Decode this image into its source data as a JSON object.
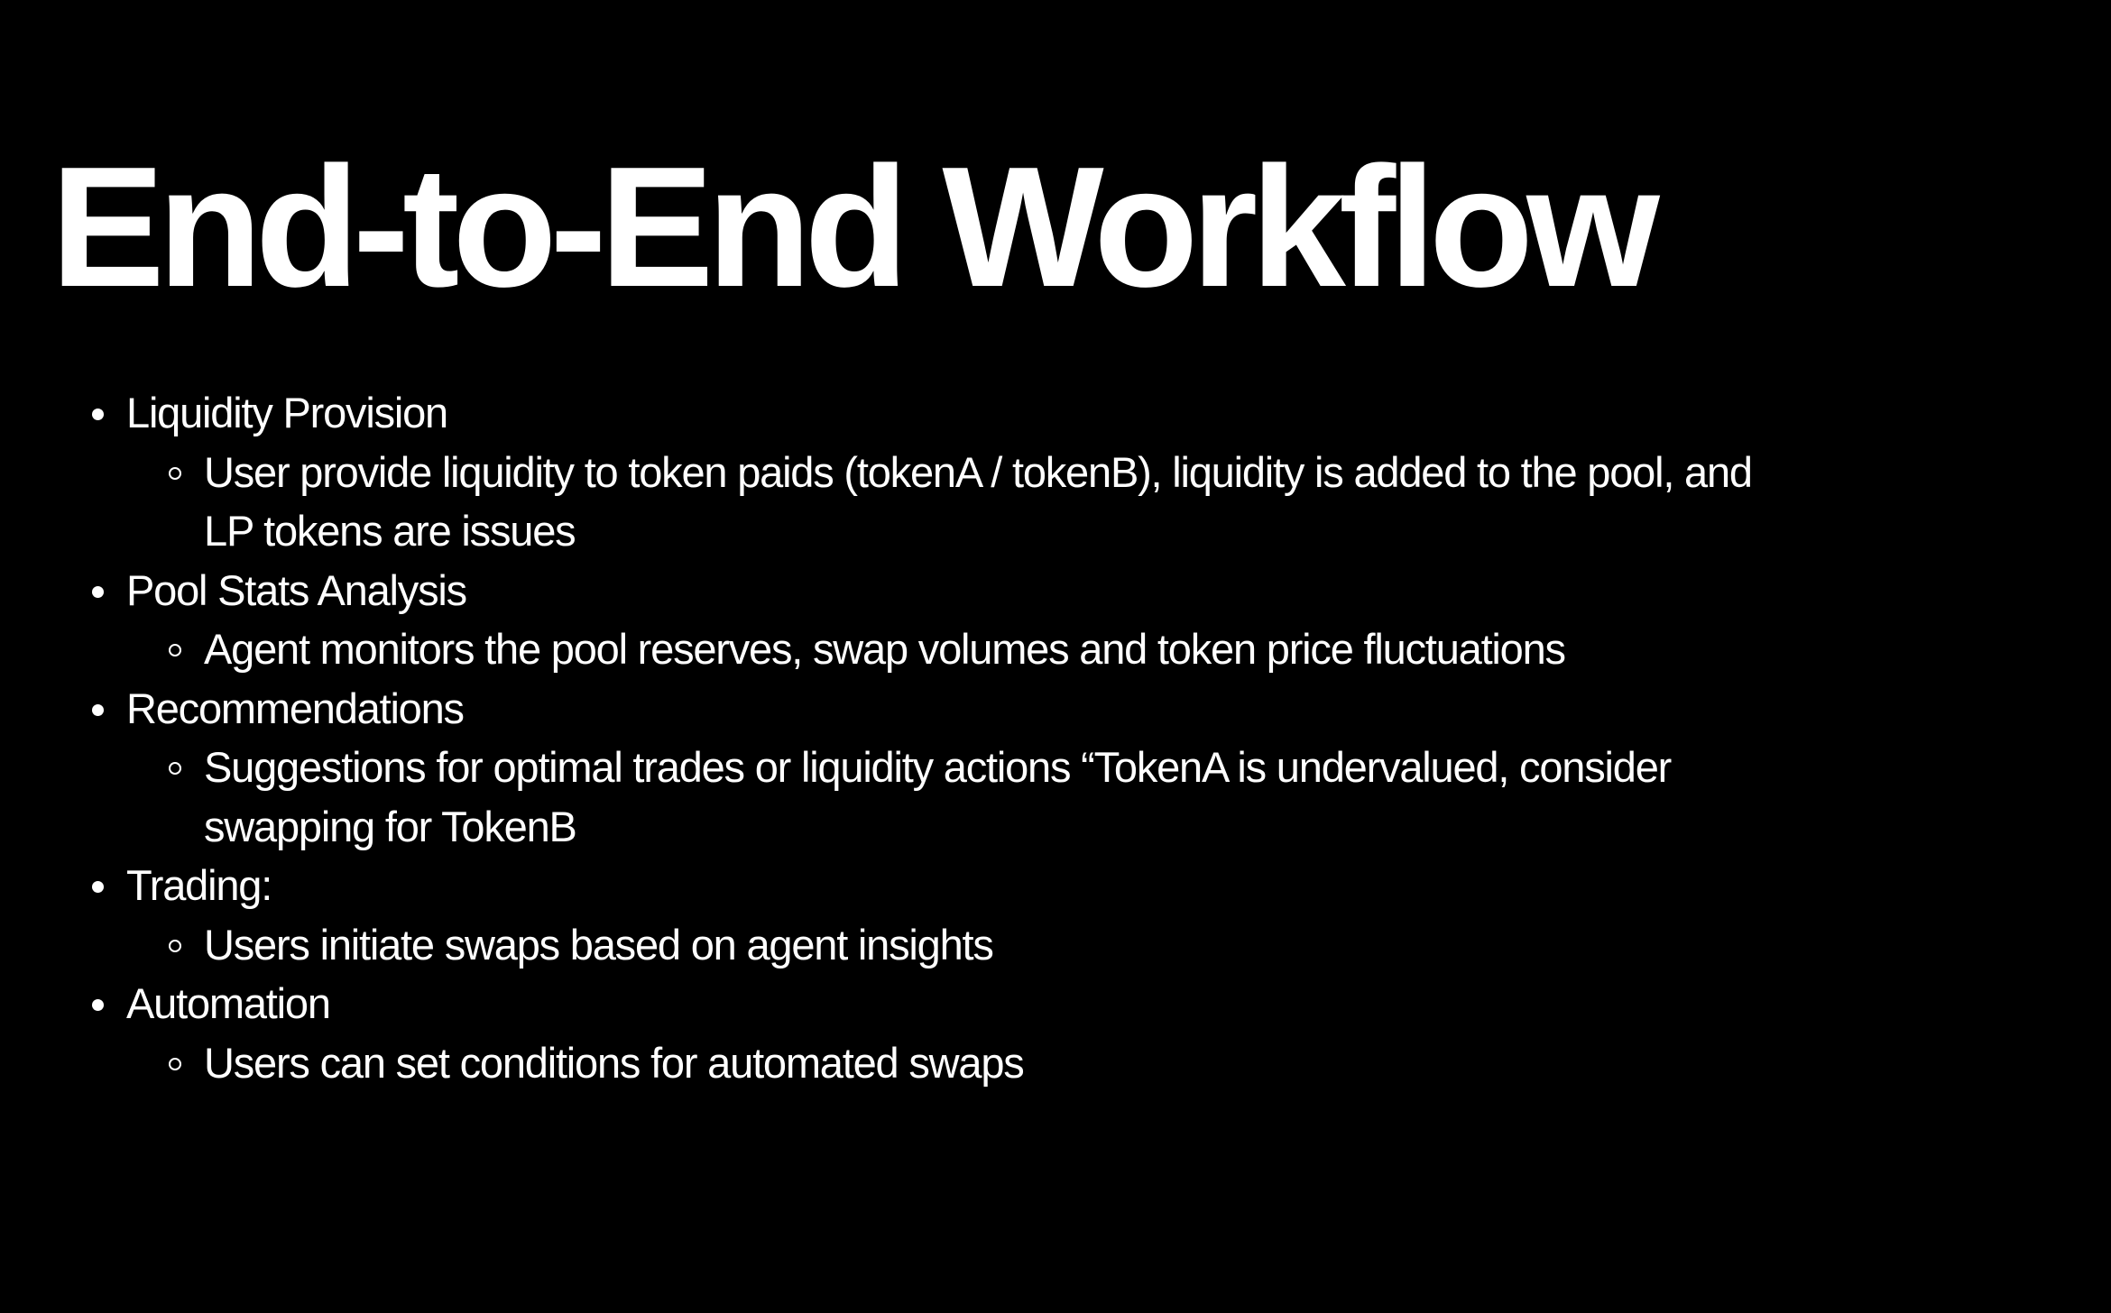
{
  "slide": {
    "title": "End-to-End Workflow",
    "items": [
      {
        "label": "Liquidity Provision",
        "sub": [
          {
            "line1": "User provide liquidity to token paids (tokenA / tokenB), liquidity is added to the pool, and",
            "line2": "LP tokens are issues"
          }
        ]
      },
      {
        "label": "Pool Stats Analysis",
        "sub": [
          {
            "line1": "Agent monitors the pool reserves, swap volumes and token price fluctuations"
          }
        ]
      },
      {
        "label": "Recommendations",
        "sub": [
          {
            "line1": "Suggestions for optimal trades or liquidity actions “TokenA is undervalued, consider",
            "line2": "swapping for TokenB"
          }
        ]
      },
      {
        "label": "Trading:",
        "sub": [
          {
            "line1": "Users initiate swaps based on agent insights"
          }
        ]
      },
      {
        "label": "Automation",
        "sub": [
          {
            "line1": "Users can set conditions for automated swaps"
          }
        ]
      }
    ]
  }
}
